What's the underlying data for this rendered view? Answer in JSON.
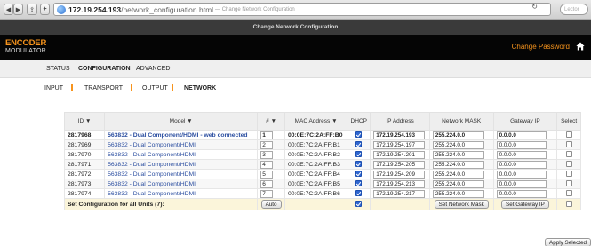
{
  "browser": {
    "url_host": "172.19.254.193",
    "url_path": "/network_configuration.html",
    "url_title": "— Change Network Configuration",
    "search_placeholder": "Lector"
  },
  "window_title": "Change Network Configuration",
  "header": {
    "logo_main": "ENCODER",
    "logo_sub": "MODULATOR",
    "change_password": "Change Password"
  },
  "tabs": [
    {
      "label": "STATUS"
    },
    {
      "label": "CONFIGURATION"
    },
    {
      "label": "ADVANCED"
    }
  ],
  "subnav": [
    {
      "label": "INPUT"
    },
    {
      "label": "TRANSPORT"
    },
    {
      "label": "OUTPUT"
    },
    {
      "label": "NETWORK"
    }
  ],
  "table": {
    "headers": [
      "ID ▼",
      "Model ▼",
      "# ▼",
      "MAC Address ▼",
      "DHCP",
      "IP Address",
      "Network MASK",
      "Gateway IP",
      "Select"
    ],
    "rows": [
      {
        "id": "2817968",
        "model": "563832 - Dual Component/HDMI - web connected",
        "unit": "1",
        "mac": "00:0E:7C:2A:FF:B0",
        "dhcp": true,
        "ip": "172.19.254.193",
        "mask": "255.224.0.0",
        "gateway": "0.0.0.0",
        "selected": false
      },
      {
        "id": "2817969",
        "model": "563832 - Dual Component/HDMI",
        "unit": "2",
        "mac": "00:0E:7C:2A:FF:B1",
        "dhcp": true,
        "ip": "172.19.254.197",
        "mask": "255.224.0.0",
        "gateway": "0.0.0.0",
        "selected": false
      },
      {
        "id": "2817970",
        "model": "563832 - Dual Component/HDMI",
        "unit": "3",
        "mac": "00:0E:7C:2A:FF:B2",
        "dhcp": true,
        "ip": "172.19.254.201",
        "mask": "255.224.0.0",
        "gateway": "0.0.0.0",
        "selected": false
      },
      {
        "id": "2817971",
        "model": "563832 - Dual Component/HDMI",
        "unit": "4",
        "mac": "00:0E:7C:2A:FF:B3",
        "dhcp": true,
        "ip": "172.19.254.205",
        "mask": "255.224.0.0",
        "gateway": "0.0.0.0",
        "selected": false
      },
      {
        "id": "2817972",
        "model": "563832 - Dual Component/HDMI",
        "unit": "5",
        "mac": "00:0E:7C:2A:FF:B4",
        "dhcp": true,
        "ip": "172.19.254.209",
        "mask": "255.224.0.0",
        "gateway": "0.0.0.0",
        "selected": false
      },
      {
        "id": "2817973",
        "model": "563832 - Dual Component/HDMI",
        "unit": "6",
        "mac": "00:0E:7C:2A:FF:B5",
        "dhcp": true,
        "ip": "172.19.254.213",
        "mask": "255.224.0.0",
        "gateway": "0.0.0.0",
        "selected": false
      },
      {
        "id": "2817974",
        "model": "563832 - Dual Component/HDMI",
        "unit": "7",
        "mac": "00:0E:7C:2A:FF:B6",
        "dhcp": true,
        "ip": "172.19.254.217",
        "mask": "255.224.0.0",
        "gateway": "0.0.0.0",
        "selected": false
      }
    ],
    "summary": {
      "label": "Set Configuration for all Units (7):",
      "auto_button": "Auto",
      "dhcp_all": true,
      "set_mask_button": "Set Network Mask",
      "set_gateway_button": "Set Gateway IP"
    }
  },
  "apply_button": "Apply Selected",
  "colors": {
    "accent": "#f7941d",
    "header_bg": "#050505",
    "link": "#2b4ea0",
    "summary_bg": "#fbf5da"
  },
  "icons": [
    "back-icon",
    "forward-icon",
    "share-icon",
    "add-tab-icon",
    "globe-icon",
    "reload-icon",
    "home-icon"
  ]
}
